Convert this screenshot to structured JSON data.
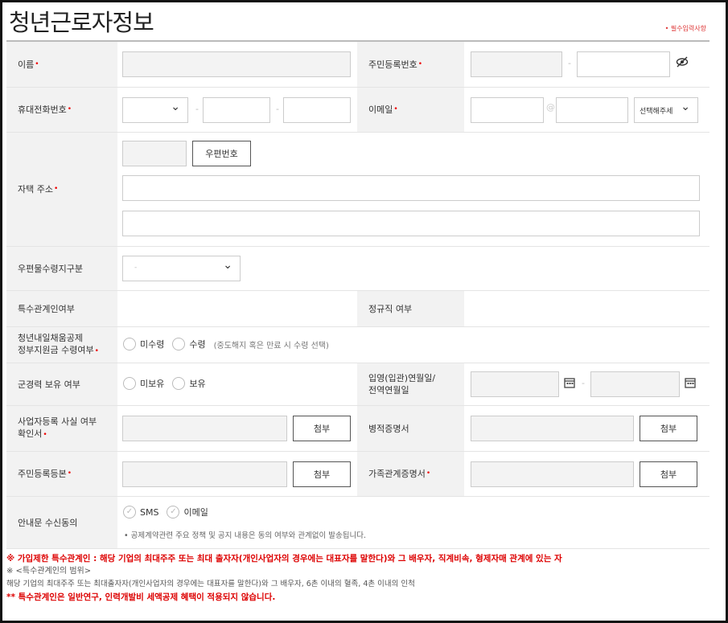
{
  "page": {
    "title": "청년근로자정보",
    "required_note": "• 필수입력사항"
  },
  "fields": {
    "name": {
      "label": "이름"
    },
    "rrn": {
      "label": "주민등록번호"
    },
    "phone": {
      "label": "휴대전화번호"
    },
    "email": {
      "label": "이메일",
      "domain_select": "선택해주세"
    },
    "address": {
      "label": "자택 주소",
      "zip_button": "우편번호"
    },
    "mail_recipient": {
      "label": "우편물수령지구분"
    },
    "special_relation": {
      "label": "특수관계인여부"
    },
    "regular": {
      "label": "정규직 여부"
    },
    "subsidy": {
      "label_line1": "청년내일채움공제",
      "label_line2": "정부지원금 수령여부",
      "option_no": "미수령",
      "option_yes": "수령",
      "note": "(중도해지 혹은 만료 시 수령 선택)"
    },
    "military": {
      "label": "군경력 보유 여부",
      "option_no": "미보유",
      "option_yes": "보유"
    },
    "enlist_date": {
      "label_line1": "입영(입관)연월일/",
      "label_line2": "전역연월일"
    },
    "business_reg": {
      "label_line1": "사업자등록 사실 여부",
      "label_line2": "확인서",
      "attach": "첨부"
    },
    "military_cert": {
      "label": "병적증명서",
      "attach": "첨부"
    },
    "resident_copy": {
      "label": "주민등록등본",
      "attach": "첨부"
    },
    "family_cert": {
      "label": "가족관계증명서",
      "attach": "첨부"
    },
    "notice_consent": {
      "label": "안내문 수신동의",
      "option_sms": "SMS",
      "option_email": "이메일",
      "note": "• 공제계약관련 주요 정책 및 공지 내용은 동의 여부와 관계없이 발송됩니다."
    }
  },
  "footer": {
    "line1": "※ 가입제한 특수관계인 : 해당 기업의 최대주주 또는 최대 출자자(개인사업자의 경우에는 대표자를 말한다)와 그 배우자, 직계비속, 형제자매 관계에 있는 자",
    "line2": "※ <특수관계인의 범위>",
    "line3": "해당 기업의 최대주주 또는 최대출자자(개인사업자의 경우에는 대표자를 말한다)와 그 배우자, 6촌 이내의 혈족, 4촌 이내의 인척",
    "line4": "** 특수관계인은 일반연구, 인력개발비 세액공제 혜택이 적용되지 않습니다."
  },
  "icons": {
    "eye_off": "eye-off-icon",
    "calendar": "calendar-icon",
    "chevron": "chevron-down-icon"
  },
  "colors": {
    "required": "#e00000",
    "header_bg": "#f2f2f2",
    "warning": "#d00000"
  }
}
